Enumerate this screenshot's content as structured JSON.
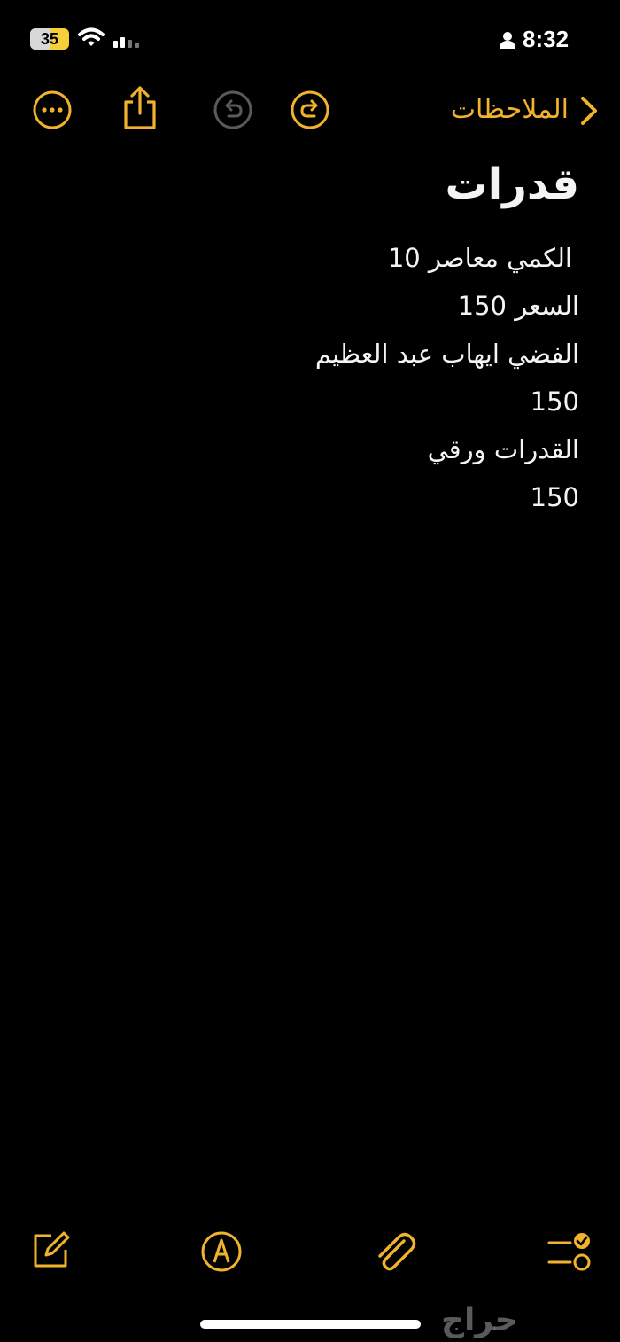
{
  "status_bar": {
    "time": "8:32",
    "battery_level": "35"
  },
  "toolbar": {
    "back_label": "الملاحظات",
    "accent_color": "#F1B32D",
    "disabled_color": "#5A5A5A",
    "icons": [
      "more-icon",
      "share-icon",
      "undo-icon",
      "redo-icon",
      "chevron-right-icon"
    ]
  },
  "note": {
    "title": "قدرات",
    "lines": [
      "الكمي معاصر 10",
      "السعر 150",
      "الفضي ايهاب عبد العظيم",
      "150",
      "القدرات ورقي",
      "150"
    ]
  },
  "bottom_bar": {
    "icons": [
      "compose-icon",
      "markup-icon",
      "attachment-icon",
      "checklist-icon"
    ]
  },
  "watermark": {
    "text": "حراج"
  }
}
